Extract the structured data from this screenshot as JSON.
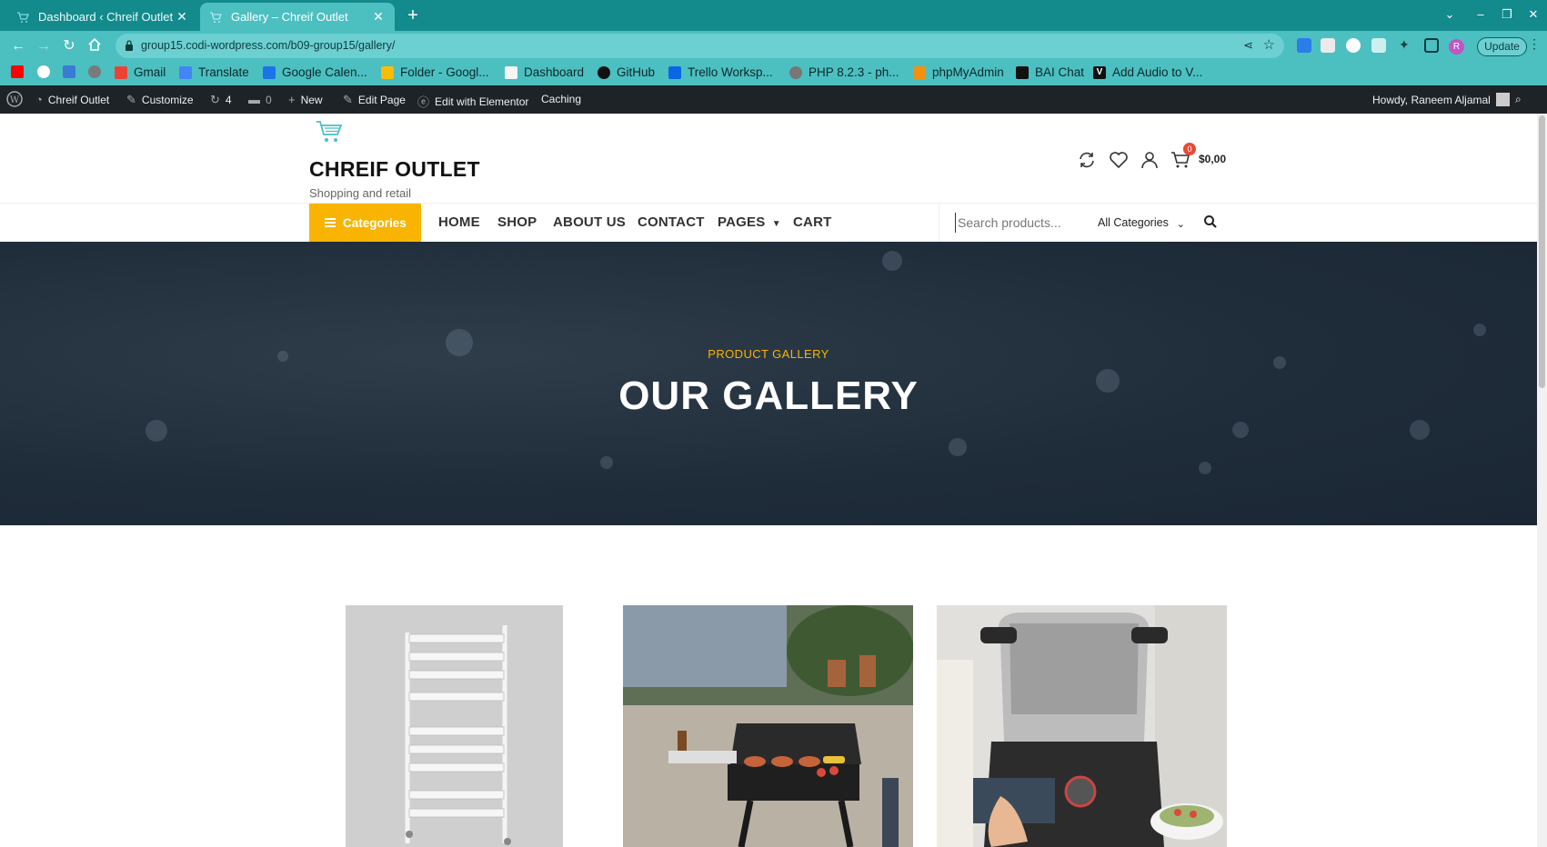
{
  "browser": {
    "tabs": [
      {
        "title": "Dashboard ‹ Chreif Outlet",
        "active": false
      },
      {
        "title": "Gallery – Chreif Outlet",
        "active": true
      }
    ],
    "url": "group15.codi-wordpress.com/b09-group15/gallery/",
    "update_label": "Update",
    "profile_initial": "R",
    "bookmarks": [
      {
        "label": "",
        "icon": "youtube-icon"
      },
      {
        "label": "",
        "icon": "google-icon"
      },
      {
        "label": "",
        "icon": "download-icon"
      },
      {
        "label": "",
        "icon": "globe-icon"
      },
      {
        "label": "Gmail",
        "icon": "gmail-icon"
      },
      {
        "label": "Translate",
        "icon": "translate-icon"
      },
      {
        "label": "Google Calen...",
        "icon": "calendar-icon"
      },
      {
        "label": "Folder - Googl...",
        "icon": "drive-icon"
      },
      {
        "label": "Dashboard",
        "icon": "doc-icon"
      },
      {
        "label": "GitHub",
        "icon": "github-icon"
      },
      {
        "label": "Trello Worksp...",
        "icon": "trello-icon"
      },
      {
        "label": "PHP 8.2.3 - ph...",
        "icon": "php-icon"
      },
      {
        "label": "phpMyAdmin",
        "icon": "phpmyadmin-icon"
      },
      {
        "label": "BAI Chat",
        "icon": "chat-icon"
      },
      {
        "label": "Add Audio to V...",
        "icon": "v-icon"
      }
    ]
  },
  "adminbar": {
    "site_name": "Chreif Outlet",
    "customize": "Customize",
    "updates_count": "4",
    "comments_count": "0",
    "new": "New",
    "edit_page": "Edit Page",
    "edit_elementor": "Edit with Elementor",
    "caching": "Caching",
    "howdy": "Howdy, Raneem Aljamal"
  },
  "header": {
    "site_title": "CHREIF OUTLET",
    "tagline": "Shopping and retail",
    "cart_count": "0",
    "cart_total": "$0,00"
  },
  "nav": {
    "categories_label": "Categories",
    "items": [
      "HOME",
      "SHOP",
      "ABOUT US",
      "CONTACT",
      "PAGES",
      "CART"
    ],
    "search_placeholder": "Search products...",
    "category_select": "All Categories"
  },
  "hero": {
    "subtitle": "PRODUCT GALLERY",
    "title": "OUR GALLERY"
  },
  "gallery": {
    "images": [
      {
        "alt": "towel-radiator-image"
      },
      {
        "alt": "bbq-grill-image"
      },
      {
        "alt": "kitchen-robot-image"
      }
    ]
  },
  "colors": {
    "browser_teal": "#138a8c",
    "toolbar_teal": "#4cbfc1",
    "adminbar": "#1d2327",
    "accent_yellow": "#f8b400",
    "hero_bg": "#1f2c3a",
    "badge_red": "#e84a36"
  }
}
